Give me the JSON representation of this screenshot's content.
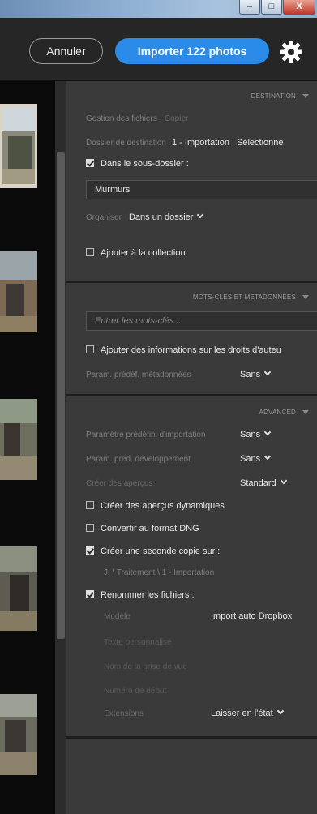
{
  "window_controls": {
    "minimize": "–",
    "maximize": "□",
    "close": "X"
  },
  "header": {
    "cancel_label": "Annuler",
    "import_label": "Importer 122 photos",
    "import_color": "#2a8be8"
  },
  "icons": {
    "settings": "gear-icon"
  },
  "destination": {
    "section_title": "DESTINATION",
    "file_handling_label": "Gestion des fichiers",
    "file_handling_value": "Copier",
    "dest_folder_label": "Dossier de destination",
    "dest_folder_value": "1 - Importation",
    "dest_folder_action": "Sélectionne",
    "subfolder_label": "Dans le sous-dossier :",
    "subfolder_checked": true,
    "subfolder_value": "Murmurs",
    "organize_label": "Organiser",
    "organize_value": "Dans un dossier",
    "add_collection_label": "Ajouter à la collection",
    "add_collection_checked": false
  },
  "keywords": {
    "section_title": "MOTS-CLES ET METADONNEES",
    "keywords_placeholder": "Entrer les mots-clés...",
    "copyright_label": "Ajouter des informations sur les droits d'auteu",
    "copyright_checked": false,
    "metadata_preset_label": "Param. prédéf. métadonnées",
    "metadata_preset_value": "Sans"
  },
  "advanced": {
    "section_title": "ADVANCED",
    "import_preset_label": "Paramètre prédéfini d'importation",
    "import_preset_value": "Sans",
    "develop_preset_label": "Param. préd. développement",
    "develop_preset_value": "Sans",
    "previews_label": "Créer des aperçus",
    "previews_value": "Standard",
    "smart_previews_label": "Créer des aperçus dynamiques",
    "smart_previews_checked": false,
    "convert_dng_label": "Convertir au format DNG",
    "convert_dng_checked": false,
    "second_copy_label": "Créer une seconde copie sur :",
    "second_copy_checked": true,
    "second_copy_path": "J: \\ Traitement \\ 1 - Importation",
    "rename_label": "Renommer les fichiers :",
    "rename_checked": true,
    "template_label": "Modèle",
    "template_value": "Import auto Dropbox",
    "custom_text_label": "Texte personnalisé",
    "shoot_name_label": "Nom de la prise de vue",
    "start_number_label": "Numéro de début",
    "extensions_label": "Extensions",
    "extensions_value": "Laisser en l'état"
  }
}
